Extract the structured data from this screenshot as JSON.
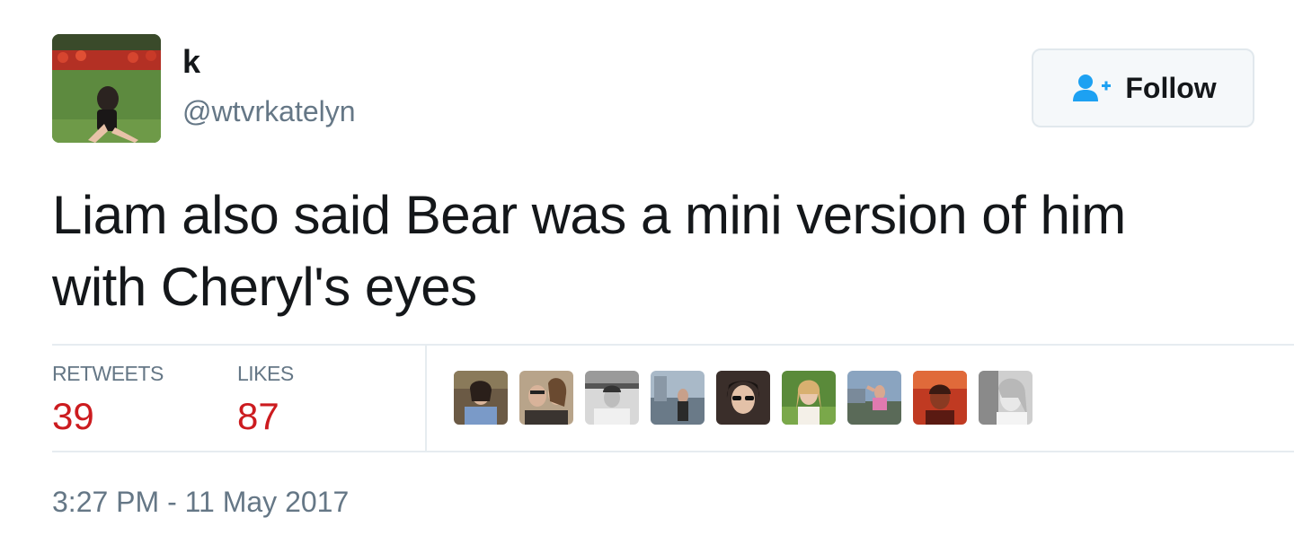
{
  "author": {
    "display_name": "k",
    "handle": "@wtvrkatelyn"
  },
  "follow_button": {
    "label": "Follow",
    "icon": "add-user-icon"
  },
  "tweet": {
    "text_line1": "Liam also said Bear was a mini version of him",
    "text_line2": "with Cheryl's eyes"
  },
  "stats": {
    "retweets_label": "RETWEETS",
    "retweets_count": "39",
    "likes_label": "LIKES",
    "likes_count": "87"
  },
  "likers_count_shown": 9,
  "timestamp": "3:27 PM - 11 May 2017",
  "colors": {
    "accent": "#1da1f2",
    "count_red": "#cc1b1f",
    "muted": "#657786"
  }
}
